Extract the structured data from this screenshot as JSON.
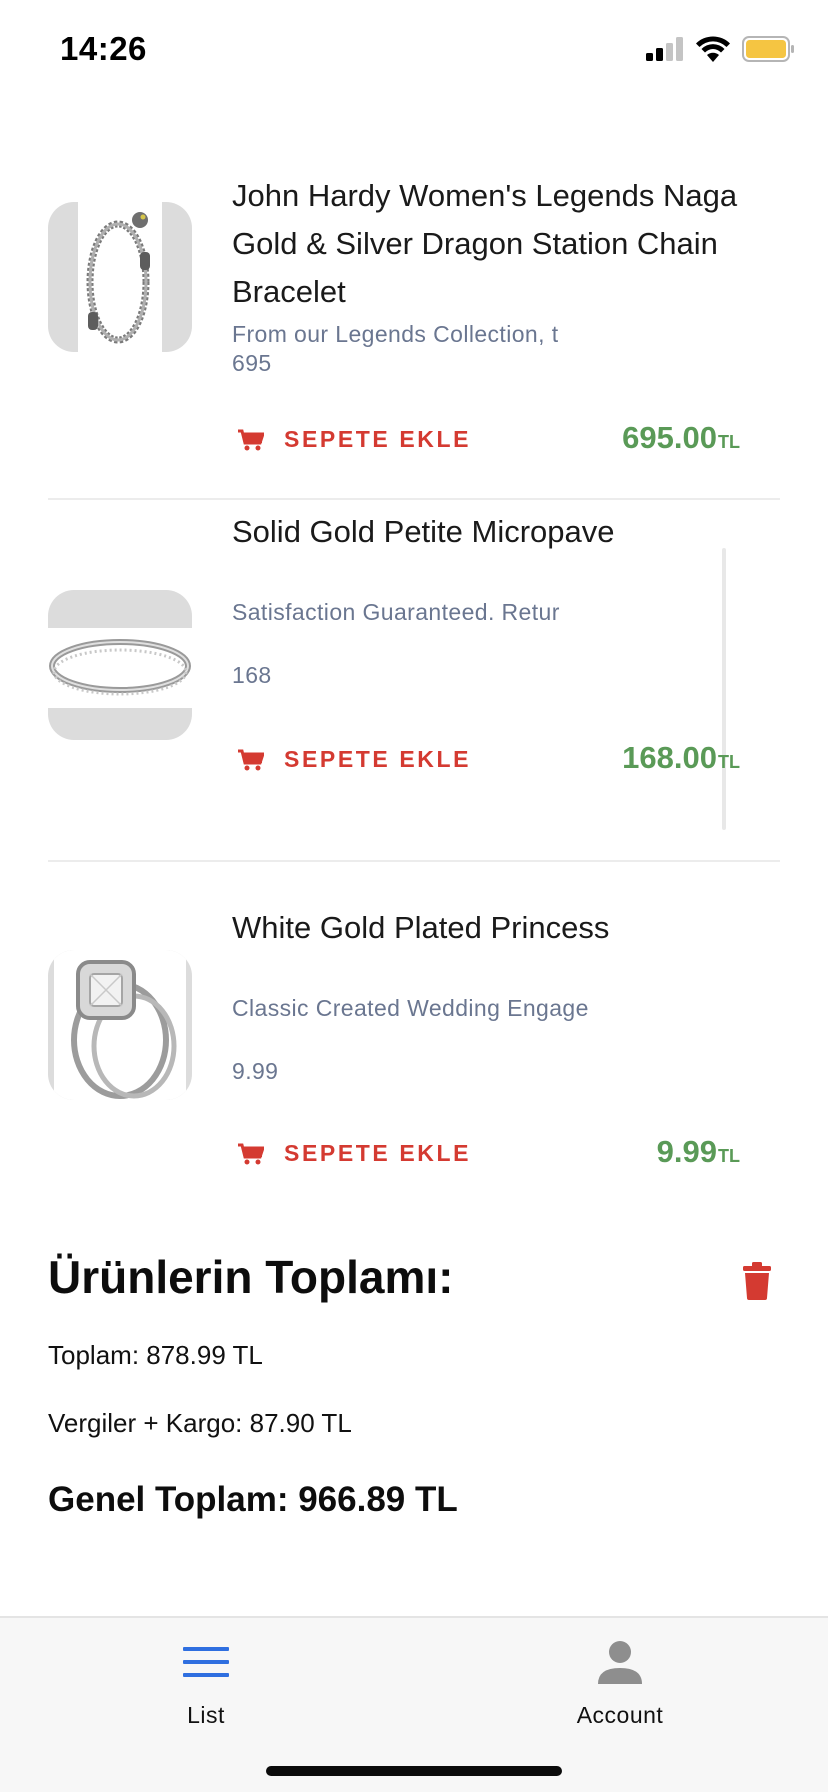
{
  "status_bar": {
    "time": "14:26"
  },
  "products": [
    {
      "title": "John Hardy Women's Legends Naga Gold & Silver Dragon Station Chain Bracelet",
      "description": "From our Legends Collection, t",
      "price_sub": "695",
      "add_label": "SEPETE EKLE",
      "price": "695.00",
      "currency": "TL",
      "image": "bracelet"
    },
    {
      "title": "Solid Gold Petite Micropave",
      "description": "Satisfaction Guaranteed. Retur",
      "price_sub": "168",
      "add_label": "SEPETE EKLE",
      "price": "168.00",
      "currency": "TL",
      "image": "ring"
    },
    {
      "title": "White Gold Plated Princess",
      "description": "Classic Created Wedding Engage",
      "price_sub": "9.99",
      "add_label": "SEPETE EKLE",
      "price": "9.99",
      "currency": "TL",
      "image": "engagement-ring-set"
    }
  ],
  "totals": {
    "title": "Ürünlerin Toplamı:",
    "subtotal": "Toplam: 878.99 TL",
    "tax_shipping": "Vergiler + Kargo: 87.90 TL",
    "grand_total": "Genel Toplam: 966.89 TL"
  },
  "tab_bar": {
    "tabs": [
      {
        "label": "List",
        "icon": "list-icon",
        "active": true
      },
      {
        "label": "Account",
        "icon": "account-icon",
        "active": false
      }
    ]
  },
  "colors": {
    "accent_red": "#d43a31",
    "price_green": "#5a9a57",
    "tab_active_blue": "#2f6fe0",
    "muted_text": "#6a7690"
  }
}
